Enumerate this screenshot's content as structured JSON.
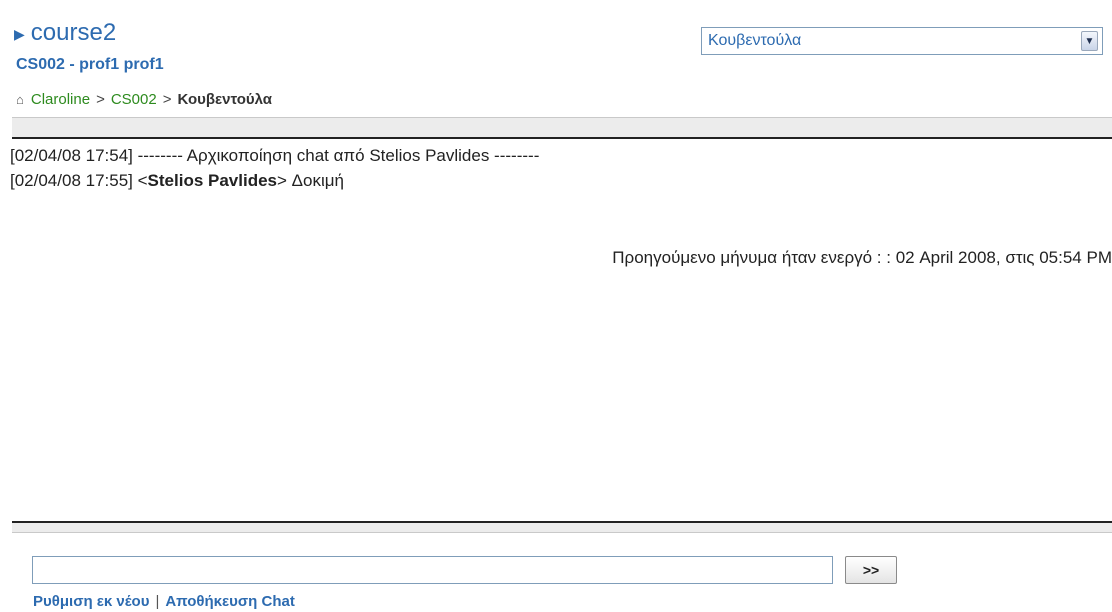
{
  "header": {
    "course_title": "course2",
    "course_sub": "CS002 - prof1 prof1"
  },
  "breadcrumb": {
    "home": "Claroline",
    "course": "CS002",
    "current": "Κουβεντούλα",
    "separator": ">"
  },
  "tool_select": {
    "selected": "Κουβεντούλα"
  },
  "chat": {
    "messages": [
      {
        "prefix": "[02/04/08 17:54] -------- Αρχικοποίηση chat από Stelios Pavlides --------",
        "author": "",
        "text": ""
      },
      {
        "prefix": "[02/04/08 17:55] <",
        "author": "Stelios Pavlides",
        "text": "> Δοκιμή"
      }
    ],
    "previous_message": "Προηγούμενο μήνυμα ήταν ενεργό : : 02 April 2008, στις 05:54 PM"
  },
  "input": {
    "value": "",
    "send_label": ">>"
  },
  "footer": {
    "reset_label": "Ρυθμιση εκ νέου",
    "separator": "|",
    "save_label": "Αποθήκευση Chat"
  },
  "colors": {
    "link_blue": "#2d6bb0",
    "link_green": "#2e8b1f",
    "bar_dark": "#222222"
  },
  "icons": {
    "title_marker": "triangle-right-icon",
    "home": "home-icon",
    "dropdown": "chevron-down-icon"
  }
}
